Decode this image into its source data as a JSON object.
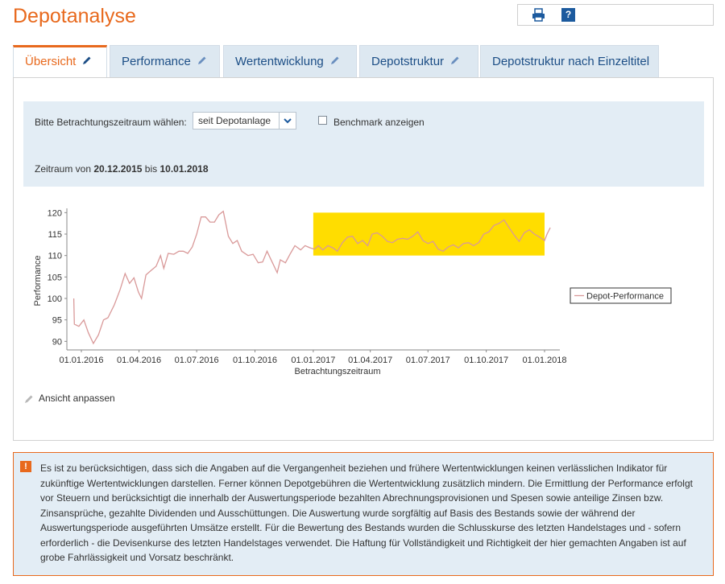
{
  "page": {
    "title": "Depotanalyse"
  },
  "toolbar": {
    "print_icon": "printer-icon",
    "help_label": "?"
  },
  "tabs": [
    {
      "label": "Übersicht",
      "active": true
    },
    {
      "label": "Performance",
      "active": false
    },
    {
      "label": "Wertentwicklung",
      "active": false
    },
    {
      "label": "Depotstruktur",
      "active": false
    },
    {
      "label": "Depotstruktur nach Einzeltitel",
      "active": false
    }
  ],
  "filter": {
    "label": "Bitte Betrachtungszeitraum wählen:",
    "select_value": "seit Depotanlage",
    "benchmark_label": "Benchmark anzeigen",
    "benchmark_checked": false,
    "period_prefix": "Zeitraum von",
    "period_from": "20.12.2015",
    "period_mid": "bis",
    "period_to": "10.01.2018"
  },
  "chart_data": {
    "type": "line",
    "xlabel": "Betrachtungszeitraum",
    "ylabel": "Performance",
    "ylim": [
      88,
      121
    ],
    "yticks": [
      90,
      95,
      100,
      105,
      110,
      115,
      120
    ],
    "xticks": [
      "01.01.2016",
      "01.04.2016",
      "01.07.2016",
      "01.10.2016",
      "01.01.2017",
      "01.04.2017",
      "01.07.2017",
      "01.10.2017",
      "01.01.2018"
    ],
    "legend": "right",
    "colors": {
      "line": "#d99999",
      "highlight": "#ffdd00"
    },
    "highlight": {
      "x_from": "01.01.2017",
      "x_to": "01.01.2018",
      "y_from": 110,
      "y_to": 120
    },
    "series": [
      {
        "name": "Depot-Performance",
        "points": [
          [
            "2015-12-20",
            100.0
          ],
          [
            "2015-12-21",
            94.0
          ],
          [
            "2015-12-28",
            93.5
          ],
          [
            "2016-01-05",
            95.0
          ],
          [
            "2016-01-12",
            92.0
          ],
          [
            "2016-01-20",
            89.5
          ],
          [
            "2016-01-28",
            91.5
          ],
          [
            "2016-02-05",
            95.0
          ],
          [
            "2016-02-12",
            95.5
          ],
          [
            "2016-02-22",
            98.5
          ],
          [
            "2016-03-02",
            102.0
          ],
          [
            "2016-03-10",
            105.8
          ],
          [
            "2016-03-17",
            103.5
          ],
          [
            "2016-03-24",
            104.8
          ],
          [
            "2016-03-31",
            101.5
          ],
          [
            "2016-04-05",
            100.0
          ],
          [
            "2016-04-12",
            105.5
          ],
          [
            "2016-04-20",
            106.5
          ],
          [
            "2016-04-28",
            107.5
          ],
          [
            "2016-05-05",
            110.0
          ],
          [
            "2016-05-10",
            107.0
          ],
          [
            "2016-05-17",
            110.5
          ],
          [
            "2016-05-26",
            110.3
          ],
          [
            "2016-06-03",
            111.0
          ],
          [
            "2016-06-10",
            111.0
          ],
          [
            "2016-06-17",
            110.5
          ],
          [
            "2016-06-24",
            112.0
          ],
          [
            "2016-07-01",
            115.0
          ],
          [
            "2016-07-08",
            119.0
          ],
          [
            "2016-07-15",
            119.0
          ],
          [
            "2016-07-22",
            117.8
          ],
          [
            "2016-07-29",
            117.8
          ],
          [
            "2016-08-05",
            119.5
          ],
          [
            "2016-08-12",
            120.3
          ],
          [
            "2016-08-20",
            114.5
          ],
          [
            "2016-08-27",
            112.8
          ],
          [
            "2016-09-03",
            113.5
          ],
          [
            "2016-09-10",
            111.0
          ],
          [
            "2016-09-20",
            110.0
          ],
          [
            "2016-09-28",
            110.3
          ],
          [
            "2016-10-06",
            108.3
          ],
          [
            "2016-10-13",
            108.5
          ],
          [
            "2016-10-20",
            111.0
          ],
          [
            "2016-10-28",
            108.5
          ],
          [
            "2016-11-05",
            106.0
          ],
          [
            "2016-11-10",
            109.0
          ],
          [
            "2016-11-18",
            108.3
          ],
          [
            "2016-11-26",
            110.5
          ],
          [
            "2016-12-03",
            112.3
          ],
          [
            "2016-12-12",
            111.3
          ],
          [
            "2016-12-19",
            112.3
          ],
          [
            "2016-12-27",
            111.8
          ],
          [
            "2017-01-03",
            111.5
          ],
          [
            "2017-01-09",
            112.3
          ],
          [
            "2017-01-16",
            111.3
          ],
          [
            "2017-01-24",
            112.3
          ],
          [
            "2017-02-01",
            111.8
          ],
          [
            "2017-02-08",
            111.0
          ],
          [
            "2017-02-16",
            113.0
          ],
          [
            "2017-02-24",
            114.3
          ],
          [
            "2017-03-04",
            114.5
          ],
          [
            "2017-03-12",
            112.8
          ],
          [
            "2017-03-20",
            113.5
          ],
          [
            "2017-03-28",
            112.3
          ],
          [
            "2017-04-04",
            115.0
          ],
          [
            "2017-04-12",
            115.3
          ],
          [
            "2017-04-20",
            114.5
          ],
          [
            "2017-04-28",
            113.3
          ],
          [
            "2017-05-06",
            113.0
          ],
          [
            "2017-05-14",
            113.8
          ],
          [
            "2017-05-22",
            114.0
          ],
          [
            "2017-05-30",
            113.8
          ],
          [
            "2017-06-07",
            114.5
          ],
          [
            "2017-06-15",
            115.5
          ],
          [
            "2017-06-23",
            113.5
          ],
          [
            "2017-07-01",
            112.8
          ],
          [
            "2017-07-09",
            113.3
          ],
          [
            "2017-07-17",
            111.5
          ],
          [
            "2017-07-25",
            111.0
          ],
          [
            "2017-08-02",
            112.0
          ],
          [
            "2017-08-10",
            112.5
          ],
          [
            "2017-08-18",
            111.8
          ],
          [
            "2017-08-26",
            112.8
          ],
          [
            "2017-09-03",
            113.0
          ],
          [
            "2017-09-11",
            112.3
          ],
          [
            "2017-09-19",
            113.0
          ],
          [
            "2017-09-27",
            115.0
          ],
          [
            "2017-10-05",
            115.5
          ],
          [
            "2017-10-13",
            117.0
          ],
          [
            "2017-10-21",
            117.5
          ],
          [
            "2017-10-29",
            118.3
          ],
          [
            "2017-11-06",
            116.5
          ],
          [
            "2017-11-14",
            114.8
          ],
          [
            "2017-11-22",
            113.3
          ],
          [
            "2017-11-30",
            115.3
          ],
          [
            "2017-12-08",
            116.0
          ],
          [
            "2017-12-16",
            115.0
          ],
          [
            "2017-12-24",
            114.3
          ],
          [
            "2018-01-01",
            113.5
          ],
          [
            "2018-01-05",
            115.0
          ],
          [
            "2018-01-10",
            116.5
          ]
        ]
      }
    ]
  },
  "adjust": {
    "label": "Ansicht anpassen"
  },
  "disclaimer": {
    "icon_label": "!",
    "text": "Es ist zu berücksichtigen, dass sich die Angaben auf die Vergangenheit beziehen und frühere Wertentwicklungen keinen verlässlichen Indikator für zukünftige Wertentwicklungen darstellen. Ferner können Depotgebühren die Wertentwicklung zusätzlich mindern. Die Ermittlung der Performance erfolgt vor Steuern und berücksichtigt die innerhalb der Auswertungsperiode bezahlten Abrechnungsprovisionen und Spesen sowie anteilige Zinsen bzw. Zinsansprüche, gezahlte Dividenden und Ausschüttungen. Die Auswertung wurde sorgfältig auf Basis des Bestands sowie der während der Auswertungsperiode ausgeführten Umsätze erstellt. Für die Bewertung des Bestands wurden die Schlusskurse des letzten Handelstages und - sofern erforderlich - die Devisenkurse des letzten Handelstages verwendet. Die Haftung für Vollständigkeit und Richtigkeit der hier gemachten Angaben ist auf grobe Fahrlässigkeit und Vorsatz beschränkt."
  }
}
